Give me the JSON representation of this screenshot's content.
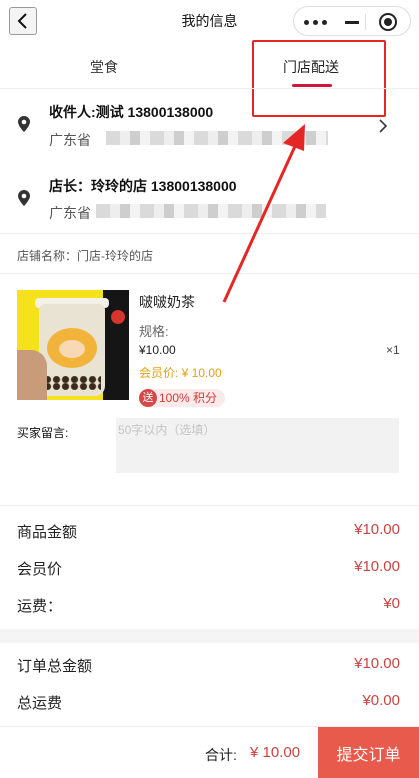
{
  "nav": {
    "title": "我的信息"
  },
  "tabs": [
    {
      "label": "堂食",
      "active": false
    },
    {
      "label": "门店配送",
      "active": true
    }
  ],
  "address": {
    "receiver": "收件人:测试 13800138000",
    "receiver_province": "广东省 ",
    "store_owner": "店长：玲玲的店 13800138000",
    "store_province": "广东省"
  },
  "store": {
    "name": "店铺名称：门店-玲玲的店"
  },
  "product": {
    "name": "啵啵奶茶",
    "spec": "规格:",
    "price": "¥10.00",
    "quantity": "×1",
    "member_price": "会员价: ¥ 10.00",
    "gift_icon": "送",
    "gift_text": "100% 积分"
  },
  "note": {
    "label": "买家留言:",
    "placeholder": "50字以内（选填）"
  },
  "summary": [
    {
      "label": "商品金额",
      "value": "¥10.00"
    },
    {
      "label": "会员价",
      "value": "¥10.00"
    },
    {
      "label": "运费：",
      "value": "¥0"
    }
  ],
  "totals": [
    {
      "label": "订单总金额",
      "value": "¥10.00"
    },
    {
      "label": "总运费",
      "value": "¥0.00"
    }
  ],
  "footer": {
    "total_label": "合计:",
    "total_value": "¥ 10.00",
    "submit_label": "提交订单"
  },
  "colors": {
    "accent": "#d0163e",
    "price": "#c8453f",
    "member": "#e3a017",
    "submit": "#e75a4c",
    "annotation": "#e52626"
  },
  "icons": [
    "back-arrow-icon",
    "more-dots-icon",
    "minimize-icon",
    "close-circle-icon",
    "location-pin-icon",
    "chevron-right-icon",
    "gift-icon"
  ]
}
